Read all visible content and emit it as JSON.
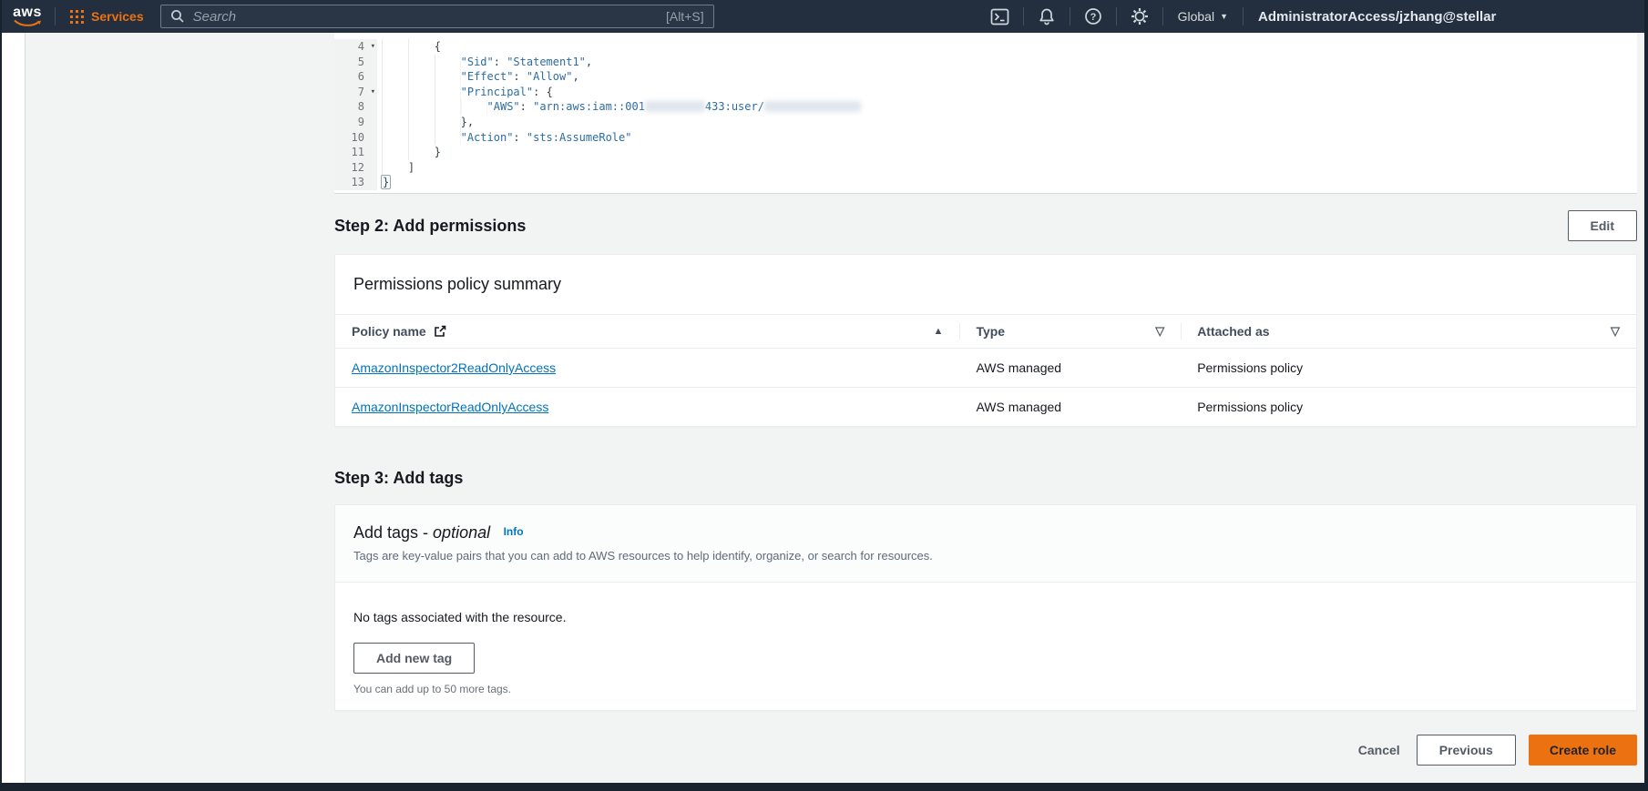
{
  "colors": {
    "accent": "#ec7211",
    "link": "#0073bb",
    "navbar": "#232f3e"
  },
  "topbar": {
    "logo": "aws",
    "services_label": "Services",
    "search": {
      "placeholder": "Search",
      "shortcut": "[Alt+S]"
    },
    "region_label": "Global",
    "account_label": "AdministratorAccess/jzhang@stellar"
  },
  "trust_policy_editor": {
    "lines": [
      {
        "num": 4,
        "fold": true,
        "indent": 8,
        "tokens": [
          {
            "text": "{",
            "type": "pun"
          }
        ]
      },
      {
        "num": 5,
        "indent": 12,
        "tokens": [
          {
            "text": "\"Sid\"",
            "type": "str"
          },
          {
            "text": ": ",
            "type": "pun"
          },
          {
            "text": "\"Statement1\"",
            "type": "str"
          },
          {
            "text": ",",
            "type": "pun"
          }
        ]
      },
      {
        "num": 6,
        "indent": 12,
        "tokens": [
          {
            "text": "\"Effect\"",
            "type": "str"
          },
          {
            "text": ": ",
            "type": "pun"
          },
          {
            "text": "\"Allow\"",
            "type": "str"
          },
          {
            "text": ",",
            "type": "pun"
          }
        ]
      },
      {
        "num": 7,
        "fold": true,
        "indent": 12,
        "tokens": [
          {
            "text": "\"Principal\"",
            "type": "str"
          },
          {
            "text": ": ",
            "type": "pun"
          },
          {
            "text": "{",
            "type": "pun"
          }
        ]
      },
      {
        "num": 8,
        "indent": 16,
        "tokens": [
          {
            "text": "\"AWS\"",
            "type": "str"
          },
          {
            "text": ": ",
            "type": "pun"
          },
          {
            "text": "\"arn:aws:iam::001",
            "type": "str"
          },
          {
            "type": "redacted",
            "width": 66
          },
          {
            "text": "433:user/",
            "type": "str"
          },
          {
            "type": "redacted",
            "width": 106
          }
        ]
      },
      {
        "num": 9,
        "indent": 12,
        "tokens": [
          {
            "text": "},",
            "type": "pun"
          }
        ]
      },
      {
        "num": 10,
        "indent": 12,
        "tokens": [
          {
            "text": "\"Action\"",
            "type": "str"
          },
          {
            "text": ": ",
            "type": "pun"
          },
          {
            "text": "\"sts:AssumeRole\"",
            "type": "str"
          }
        ]
      },
      {
        "num": 11,
        "indent": 8,
        "tokens": [
          {
            "text": "}",
            "type": "pun"
          }
        ]
      },
      {
        "num": 12,
        "indent": 4,
        "tokens": [
          {
            "text": "]",
            "type": "pun"
          }
        ]
      },
      {
        "num": 13,
        "indent": 0,
        "tokens": [
          {
            "text": "}",
            "type": "pun-boxed"
          }
        ]
      }
    ]
  },
  "step2": {
    "heading": "Step 2: Add permissions",
    "edit_button": "Edit",
    "panel_title": "Permissions policy summary",
    "table": {
      "columns": [
        {
          "label": "Policy name"
        },
        {
          "label": "Type"
        },
        {
          "label": "Attached as"
        }
      ],
      "rows": [
        {
          "policy_name": "AmazonInspector2ReadOnlyAccess",
          "type": "AWS managed",
          "attached_as": "Permissions policy"
        },
        {
          "policy_name": "AmazonInspectorReadOnlyAccess",
          "type": "AWS managed",
          "attached_as": "Permissions policy"
        }
      ]
    }
  },
  "step3": {
    "heading": "Step 3: Add tags",
    "panel_title_prefix": "Add tags - ",
    "panel_title_optional": "optional",
    "info_link": "Info",
    "description": "Tags are key-value pairs that you can add to AWS resources to help identify, organize, or search for resources.",
    "empty_message": "No tags associated with the resource.",
    "add_tag_button": "Add new tag",
    "limit_note": "You can add up to 50 more tags."
  },
  "footer": {
    "cancel": "Cancel",
    "previous": "Previous",
    "create": "Create role"
  }
}
